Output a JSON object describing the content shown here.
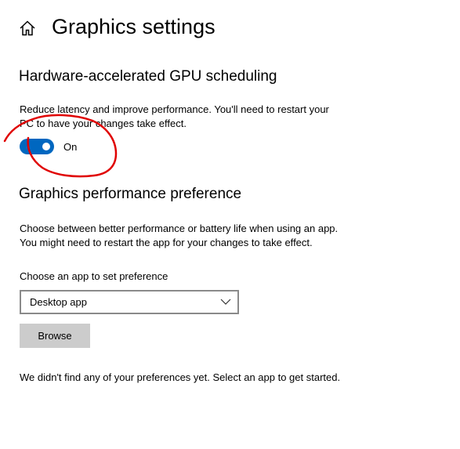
{
  "header": {
    "title": "Graphics settings",
    "home_icon": "home-icon"
  },
  "gpu_scheduling": {
    "title": "Hardware-accelerated GPU scheduling",
    "description_line1": "Reduce latency and improve performance. You'll need to restart your",
    "description_line2": "PC to have your changes take effect.",
    "toggle_state": "On",
    "toggle_on": true
  },
  "performance_preference": {
    "title": "Graphics performance preference",
    "description_line1": "Choose between better performance or battery life when using an app.",
    "description_line2": "You might need to restart the app for your changes to take effect.",
    "select_label": "Choose an app to set preference",
    "select_value": "Desktop app",
    "browse_label": "Browse",
    "empty_message": "We didn't find any of your preferences yet. Select an app to get started."
  },
  "colors": {
    "accent": "#0067c0",
    "button_bg": "#cccccc",
    "annotation_red": "#e00000"
  }
}
